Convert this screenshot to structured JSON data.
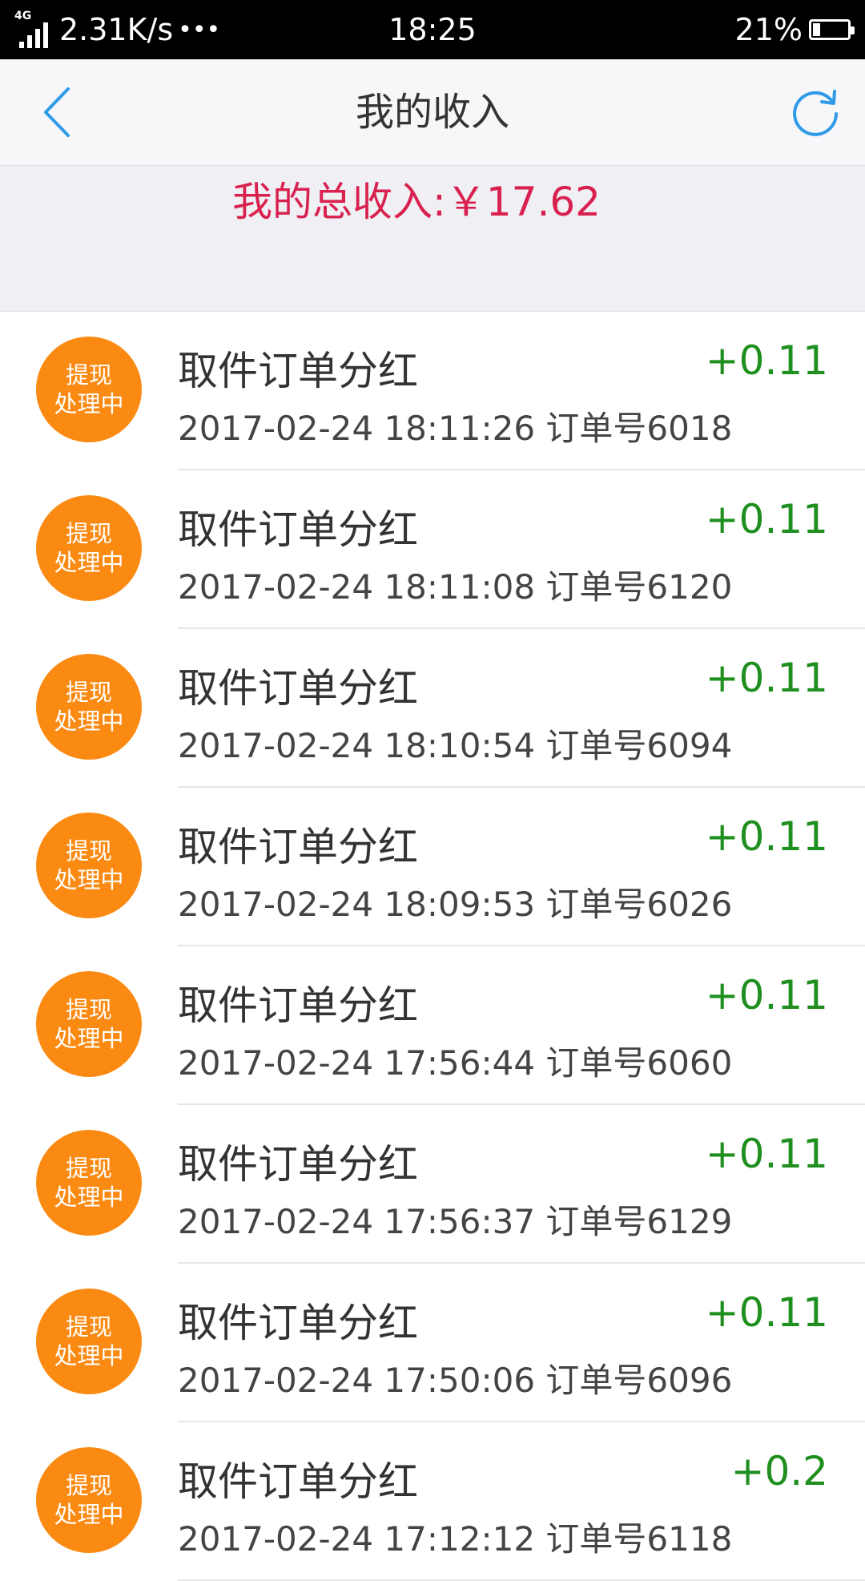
{
  "status_bar": {
    "network_type": "4G",
    "speed": "2.31K/s",
    "more": "•••",
    "time": "18:25",
    "battery_percent": "21%",
    "battery_level": 0.21
  },
  "nav": {
    "title": "我的收入",
    "back_icon": "chevron-left-icon",
    "refresh_icon": "refresh-icon",
    "accent_color": "#2f9be8"
  },
  "summary": {
    "total_income": "我的总收入:￥17.62",
    "color": "#d9214f"
  },
  "badge": {
    "line1": "提现",
    "line2": "处理中",
    "color": "#fb8a12"
  },
  "items": [
    {
      "title": "取件订单分红",
      "meta": "2017-02-24 18:11:26 订单号6018",
      "amount": "+0.11"
    },
    {
      "title": "取件订单分红",
      "meta": "2017-02-24 18:11:08 订单号6120",
      "amount": "+0.11"
    },
    {
      "title": "取件订单分红",
      "meta": "2017-02-24 18:10:54 订单号6094",
      "amount": "+0.11"
    },
    {
      "title": "取件订单分红",
      "meta": "2017-02-24 18:09:53 订单号6026",
      "amount": "+0.11"
    },
    {
      "title": "取件订单分红",
      "meta": "2017-02-24 17:56:44 订单号6060",
      "amount": "+0.11"
    },
    {
      "title": "取件订单分红",
      "meta": "2017-02-24 17:56:37 订单号6129",
      "amount": "+0.11"
    },
    {
      "title": "取件订单分红",
      "meta": "2017-02-24 17:50:06 订单号6096",
      "amount": "+0.11"
    },
    {
      "title": "取件订单分红",
      "meta": "2017-02-24 17:12:12 订单号6118",
      "amount": "+0.2"
    }
  ],
  "amount_color": "#1f8f1f"
}
